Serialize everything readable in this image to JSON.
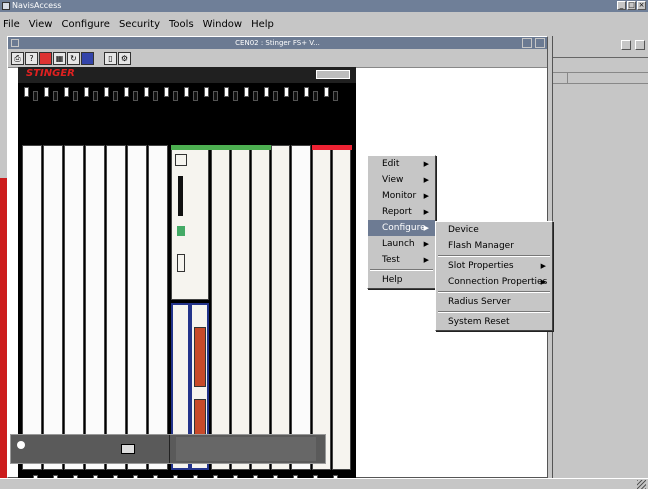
{
  "app": {
    "title": "NavisAccess",
    "window_buttons": [
      "_",
      "□",
      "×"
    ]
  },
  "menubar": {
    "items": [
      "File",
      "View",
      "Configure",
      "Security",
      "Tools",
      "Window",
      "Help"
    ]
  },
  "chassis_window": {
    "title": "CEN02 : Stinger FS+ V...",
    "brand": "STINGER"
  },
  "context_menu": {
    "items": [
      {
        "label": "Edit",
        "has_submenu": true
      },
      {
        "label": "View",
        "has_submenu": true
      },
      {
        "label": "Monitor",
        "has_submenu": true
      },
      {
        "label": "Report",
        "has_submenu": true
      },
      {
        "label": "Configure",
        "has_submenu": true,
        "selected": true
      },
      {
        "label": "Launch",
        "has_submenu": true
      },
      {
        "label": "Test",
        "has_submenu": true
      },
      {
        "label": "Help",
        "has_submenu": false
      }
    ]
  },
  "configure_submenu": {
    "items": [
      {
        "label": "Device",
        "has_submenu": false
      },
      {
        "label": "Flash Manager",
        "has_submenu": false
      },
      {
        "label": "Slot Properties",
        "has_submenu": true
      },
      {
        "label": "Connection Properties",
        "has_submenu": true
      },
      {
        "label": "Radius Server",
        "has_submenu": false
      },
      {
        "label": "System Reset",
        "has_submenu": false
      }
    ]
  },
  "colors": {
    "titlebar": "#6b7a92",
    "selection": "#6d7b93",
    "brand_red": "#e02020",
    "edge_red": "#cc1c1c"
  }
}
